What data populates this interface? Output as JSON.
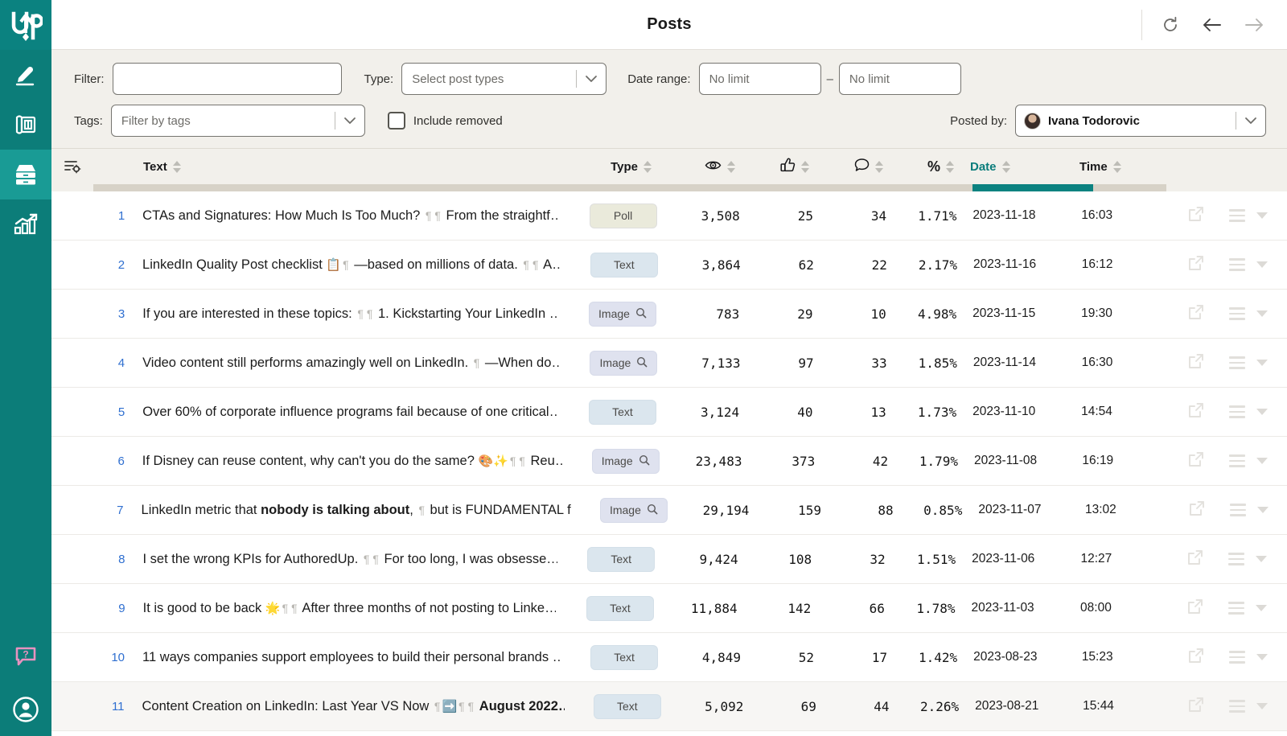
{
  "app": {
    "brand": "AuthoredUp",
    "title": "Posts"
  },
  "topbar": {
    "title": "Posts",
    "refresh_icon": "refresh-icon",
    "back_icon": "arrow-left-icon",
    "forward_icon": "arrow-right-icon"
  },
  "sidebar": {
    "logo": "up-logo",
    "items": [
      {
        "name": "editor",
        "icon": "pen-icon"
      },
      {
        "name": "templates",
        "icon": "layout-blueprint-icon"
      },
      {
        "name": "posts",
        "icon": "drawer-archive-icon",
        "active": true
      },
      {
        "name": "analytics",
        "icon": "bar-chart-trend-icon"
      }
    ],
    "bottom_items": [
      {
        "name": "help",
        "icon": "help-chat-icon"
      },
      {
        "name": "account",
        "icon": "user-circle-icon"
      }
    ]
  },
  "filters": {
    "filter_label": "Filter:",
    "filter_value": "",
    "filter_placeholder": "",
    "type_label": "Type:",
    "type_value": "Select post types",
    "date_range_label": "Date range:",
    "date_from": "No limit",
    "date_to": "No limit",
    "date_dash": "–",
    "tags_label": "Tags:",
    "tags_value": "Filter by tags",
    "include_removed_label": "Include removed",
    "include_removed_checked": false,
    "posted_by_label": "Posted by:",
    "posted_by_value": "Ivana Todorovic"
  },
  "table": {
    "columns": {
      "settings_icon": "column-settings-icon",
      "text": "Text",
      "type": "Type",
      "views_icon": "eye-icon",
      "likes_icon": "thumbs-up-icon",
      "comments_icon": "comment-bubble-icon",
      "percent": "%",
      "date": "Date",
      "time": "Time"
    },
    "sorted_by": "Date",
    "sort_direction": "desc",
    "rows": [
      {
        "num": "1",
        "text_parts": [
          {
            "t": "CTAs and Signatures: How Much Is Too Much? ",
            "s": "n"
          },
          {
            "t": "¶",
            "s": "p"
          },
          {
            "t": "¶",
            "s": "p"
          },
          {
            "t": " From the straightf…",
            "s": "n"
          }
        ],
        "type": "Poll",
        "type_class": "poll",
        "has_zoom": false,
        "views": "3,508",
        "likes": "25",
        "comments": "34",
        "pct": "1.71%",
        "date": "2023-11-18",
        "time": "16:03"
      },
      {
        "num": "2",
        "text_parts": [
          {
            "t": "LinkedIn Quality Post checklist ",
            "s": "n"
          },
          {
            "t": "📋",
            "s": "e"
          },
          {
            "t": "¶",
            "s": "p"
          },
          {
            "t": " —based on millions of data. ",
            "s": "n"
          },
          {
            "t": "¶",
            "s": "p"
          },
          {
            "t": "¶",
            "s": "p"
          },
          {
            "t": " A…",
            "s": "n"
          }
        ],
        "type": "Text",
        "type_class": "text",
        "has_zoom": false,
        "views": "3,864",
        "likes": "62",
        "comments": "22",
        "pct": "2.17%",
        "date": "2023-11-16",
        "time": "16:12"
      },
      {
        "num": "3",
        "text_parts": [
          {
            "t": "If you are interested in these topics: ",
            "s": "n"
          },
          {
            "t": "¶",
            "s": "p"
          },
          {
            "t": "¶",
            "s": "p"
          },
          {
            "t": " 1. Kickstarting Your LinkedIn …",
            "s": "n"
          }
        ],
        "type": "Image",
        "type_class": "image",
        "has_zoom": true,
        "views": "783",
        "likes": "29",
        "comments": "10",
        "pct": "4.98%",
        "date": "2023-11-15",
        "time": "19:30"
      },
      {
        "num": "4",
        "text_parts": [
          {
            "t": "Video content still performs amazingly well on LinkedIn. ",
            "s": "n"
          },
          {
            "t": "¶",
            "s": "p"
          },
          {
            "t": " —When do…",
            "s": "n"
          }
        ],
        "type": "Image",
        "type_class": "image",
        "has_zoom": true,
        "views": "7,133",
        "likes": "97",
        "comments": "33",
        "pct": "1.85%",
        "date": "2023-11-14",
        "time": "16:30"
      },
      {
        "num": "5",
        "text_parts": [
          {
            "t": "Over 60% of corporate influence programs fail because of one critical…",
            "s": "n"
          }
        ],
        "type": "Text",
        "type_class": "text",
        "has_zoom": false,
        "views": "3,124",
        "likes": "40",
        "comments": "13",
        "pct": "1.73%",
        "date": "2023-11-10",
        "time": "14:54"
      },
      {
        "num": "6",
        "text_parts": [
          {
            "t": "If Disney can reuse content, why can't you do the same? ",
            "s": "n"
          },
          {
            "t": "🎨✨",
            "s": "e"
          },
          {
            "t": "¶",
            "s": "p"
          },
          {
            "t": "¶",
            "s": "p"
          },
          {
            "t": " Reu…",
            "s": "n"
          }
        ],
        "type": "Image",
        "type_class": "image",
        "has_zoom": true,
        "views": "23,483",
        "likes": "373",
        "comments": "42",
        "pct": "1.79%",
        "date": "2023-11-08",
        "time": "16:19"
      },
      {
        "num": "7",
        "text_parts": [
          {
            "t": "LinkedIn metric that ",
            "s": "n"
          },
          {
            "t": "nobody is talking about",
            "s": "b"
          },
          {
            "t": ", ",
            "s": "n"
          },
          {
            "t": "¶",
            "s": "p"
          },
          {
            "t": " but is FUNDAMENTAL f…",
            "s": "n"
          }
        ],
        "type": "Image",
        "type_class": "image",
        "has_zoom": true,
        "views": "29,194",
        "likes": "159",
        "comments": "88",
        "pct": "0.85%",
        "date": "2023-11-07",
        "time": "13:02"
      },
      {
        "num": "8",
        "text_parts": [
          {
            "t": "I set the wrong KPIs for AuthoredUp. ",
            "s": "n"
          },
          {
            "t": "¶",
            "s": "p"
          },
          {
            "t": "¶",
            "s": "p"
          },
          {
            "t": " For too long, I was obsesse…",
            "s": "n"
          }
        ],
        "type": "Text",
        "type_class": "text",
        "has_zoom": false,
        "views": "9,424",
        "likes": "108",
        "comments": "32",
        "pct": "1.51%",
        "date": "2023-11-06",
        "time": "12:27"
      },
      {
        "num": "9",
        "text_parts": [
          {
            "t": "It is good to be back ",
            "s": "n"
          },
          {
            "t": "🌟",
            "s": "e"
          },
          {
            "t": "¶",
            "s": "p"
          },
          {
            "t": "¶",
            "s": "p"
          },
          {
            "t": " After three months of not posting to Linke…",
            "s": "n"
          }
        ],
        "type": "Text",
        "type_class": "text",
        "has_zoom": false,
        "views": "11,884",
        "likes": "142",
        "comments": "66",
        "pct": "1.78%",
        "date": "2023-11-03",
        "time": "08:00"
      },
      {
        "num": "10",
        "text_parts": [
          {
            "t": "11 ways companies support employees to build their personal brands …",
            "s": "n"
          }
        ],
        "type": "Text",
        "type_class": "text",
        "has_zoom": false,
        "views": "4,849",
        "likes": "52",
        "comments": "17",
        "pct": "1.42%",
        "date": "2023-08-23",
        "time": "15:23"
      },
      {
        "num": "11",
        "highlight": true,
        "text_parts": [
          {
            "t": "Content Creation on LinkedIn: Last Year VS Now ",
            "s": "n"
          },
          {
            "t": "¶",
            "s": "p"
          },
          {
            "t": "➡️",
            "s": "e"
          },
          {
            "t": "¶",
            "s": "p"
          },
          {
            "t": "¶",
            "s": "p"
          },
          {
            "t": " ",
            "s": "n"
          },
          {
            "t": "August 2022…",
            "s": "b"
          }
        ],
        "type": "Text",
        "type_class": "text",
        "has_zoom": false,
        "views": "5,092",
        "likes": "69",
        "comments": "44",
        "pct": "2.26%",
        "date": "2023-08-21",
        "time": "15:44"
      }
    ],
    "row_actions": {
      "open_icon": "external-link-icon",
      "menu_icon": "hamburger-menu-icon",
      "caret_icon": "caret-down-icon"
    }
  },
  "colors": {
    "brand_teal": "#0b8280",
    "sidebar_teal": "#0c7d79",
    "active_teal": "#199b95",
    "filter_bg": "#f2f0eb",
    "row_number_blue": "#2f6fd0",
    "help_pink": "#e892c0"
  }
}
